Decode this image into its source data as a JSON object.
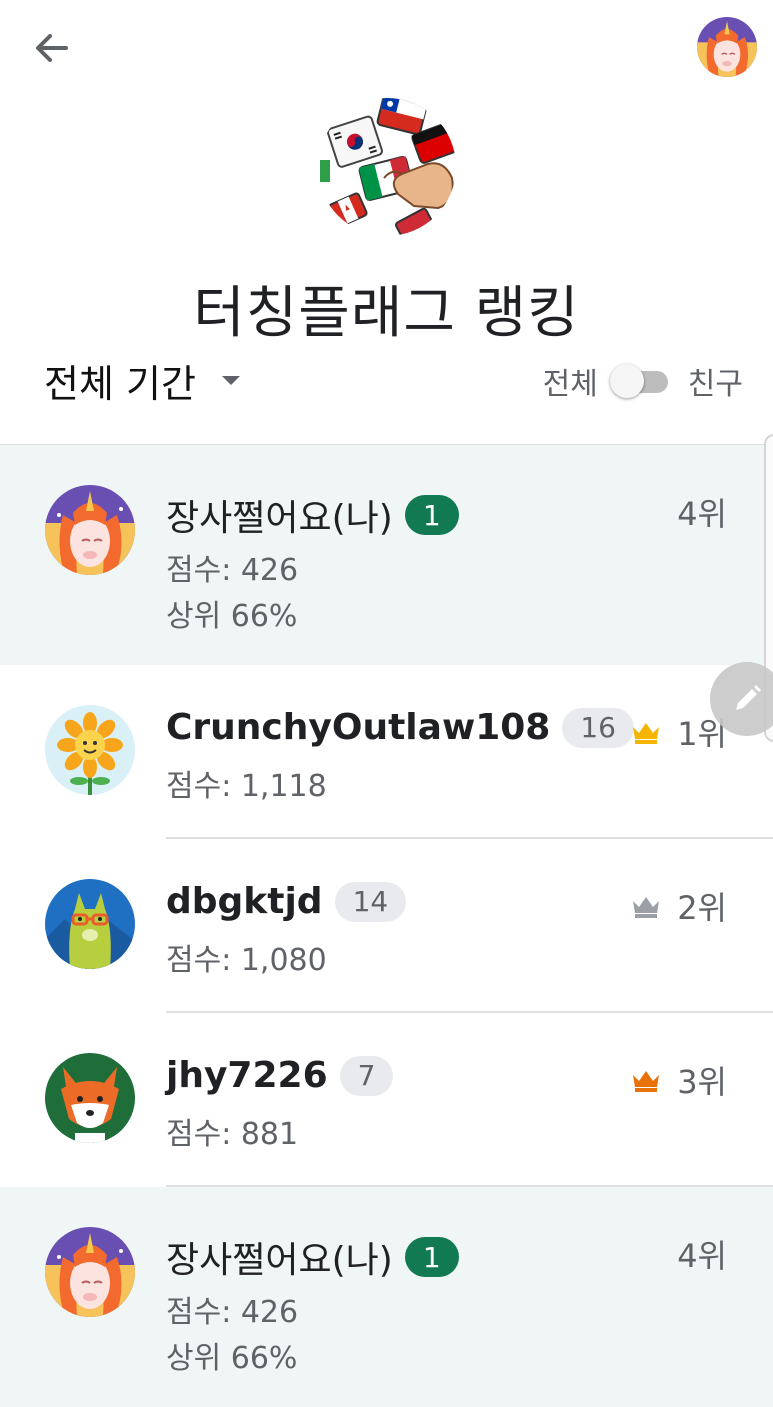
{
  "header": {
    "back_icon": "arrow-left-icon",
    "profile_icon": "unicorn-avatar"
  },
  "page": {
    "title": "터칭플래그 랭킹",
    "hero_icon": "flags-touch-icon"
  },
  "filter": {
    "period_label": "전체 기간",
    "toggle_left": "전체",
    "toggle_right": "친구",
    "toggle_on": false
  },
  "rows": [
    {
      "type": "me",
      "name": "장사쩔어요(나)",
      "level": "1",
      "score": "점수: 426",
      "percentile": "상위 66%",
      "rank": "4위",
      "avatar": "unicorn-avatar"
    },
    {
      "type": "other",
      "name": "CrunchyOutlaw108",
      "level": "16",
      "score": "점수: 1,118",
      "rank": "1위",
      "crown": "gold-crown-icon",
      "crown_color": "#f4b400",
      "avatar": "sunflower-avatar"
    },
    {
      "type": "other",
      "name": "dbgktjd",
      "level": "14",
      "score": "점수: 1,080",
      "rank": "2위",
      "crown": "silver-crown-icon",
      "crown_color": "#9aa0a6",
      "avatar": "llama-avatar"
    },
    {
      "type": "other",
      "name": "jhy7226",
      "level": "7",
      "score": "점수: 881",
      "rank": "3위",
      "crown": "bronze-crown-icon",
      "crown_color": "#e8710a",
      "avatar": "fox-avatar"
    },
    {
      "type": "me",
      "name": "장사쩔어요(나)",
      "level": "1",
      "score": "점수: 426",
      "percentile": "상위 66%",
      "rank": "4위",
      "avatar": "unicorn-avatar"
    }
  ],
  "fab": {
    "icon": "pencil-icon"
  },
  "colors": {
    "accent_green": "#127a53",
    "me_row_bg": "#f0f6f5"
  }
}
